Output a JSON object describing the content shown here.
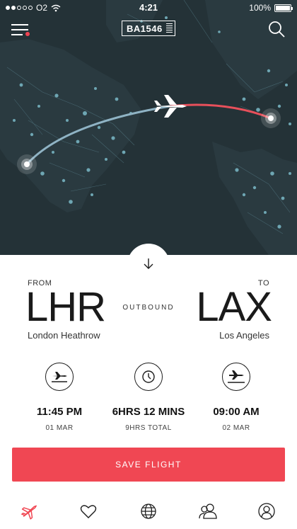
{
  "status_bar": {
    "carrier": "O2",
    "time": "4:21",
    "battery": "100%",
    "battery_level": 1.0
  },
  "header": {
    "flight_number": "BA1546"
  },
  "route": {
    "from_label": "FROM",
    "to_label": "TO",
    "origin_code": "LHR",
    "destination_code": "LAX",
    "direction": "OUTBOUND",
    "origin_city": "London Heathrow",
    "destination_city": "Los Angeles"
  },
  "details": [
    {
      "icon": "takeoff-icon",
      "value": "11:45 PM",
      "sub": "01 MAR"
    },
    {
      "icon": "clock-icon",
      "value": "6HRS 12 MINS",
      "sub": "9HRS TOTAL"
    },
    {
      "icon": "landing-icon",
      "value": "09:00 AM",
      "sub": "02 MAR"
    }
  ],
  "actions": {
    "save_label": "SAVE FLIGHT"
  },
  "tabs": [
    {
      "icon": "flights-icon",
      "active": true
    },
    {
      "icon": "heart-icon",
      "active": false
    },
    {
      "icon": "globe-icon",
      "active": false
    },
    {
      "icon": "people-icon",
      "active": false
    },
    {
      "icon": "profile-icon",
      "active": false
    }
  ],
  "colors": {
    "accent": "#f04753",
    "map_bg": "#243237",
    "route_past": "#8fb3c4",
    "route_future": "#e8505b"
  }
}
